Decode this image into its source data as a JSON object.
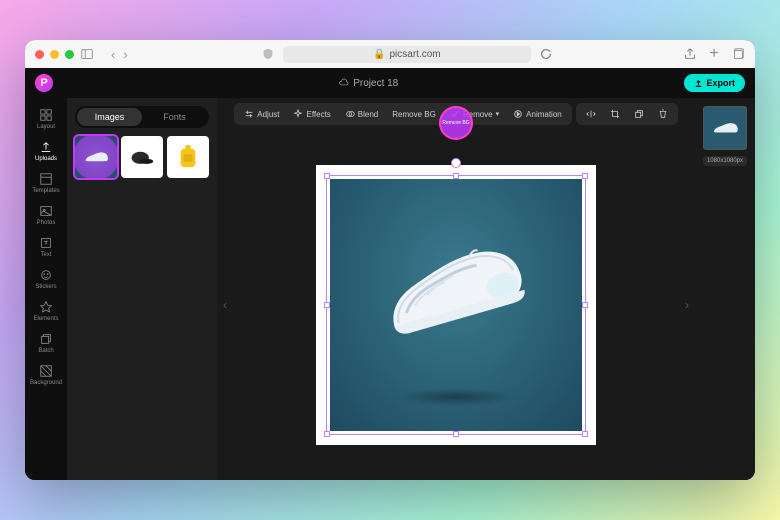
{
  "browser": {
    "url": "picsart.com"
  },
  "app": {
    "project_title": "Project 18",
    "export_label": "Export"
  },
  "rail": {
    "items": [
      {
        "label": "Layout"
      },
      {
        "label": "Uploads"
      },
      {
        "label": "Templates"
      },
      {
        "label": "Photos"
      },
      {
        "label": "Text"
      },
      {
        "label": "Stickers"
      },
      {
        "label": "Elements"
      },
      {
        "label": "Batch"
      },
      {
        "label": "Background"
      }
    ]
  },
  "panel": {
    "tabs": {
      "images": "Images",
      "fonts": "Fonts"
    }
  },
  "toolbar": {
    "adjust": "Adjust",
    "effects": "Effects",
    "blend": "Blend",
    "removebg": "Remove BG",
    "remove": "Remove",
    "animation": "Animation"
  },
  "canvas": {
    "dimensions": "1080x1080px"
  },
  "highlight": {
    "label": "Remove BG"
  }
}
